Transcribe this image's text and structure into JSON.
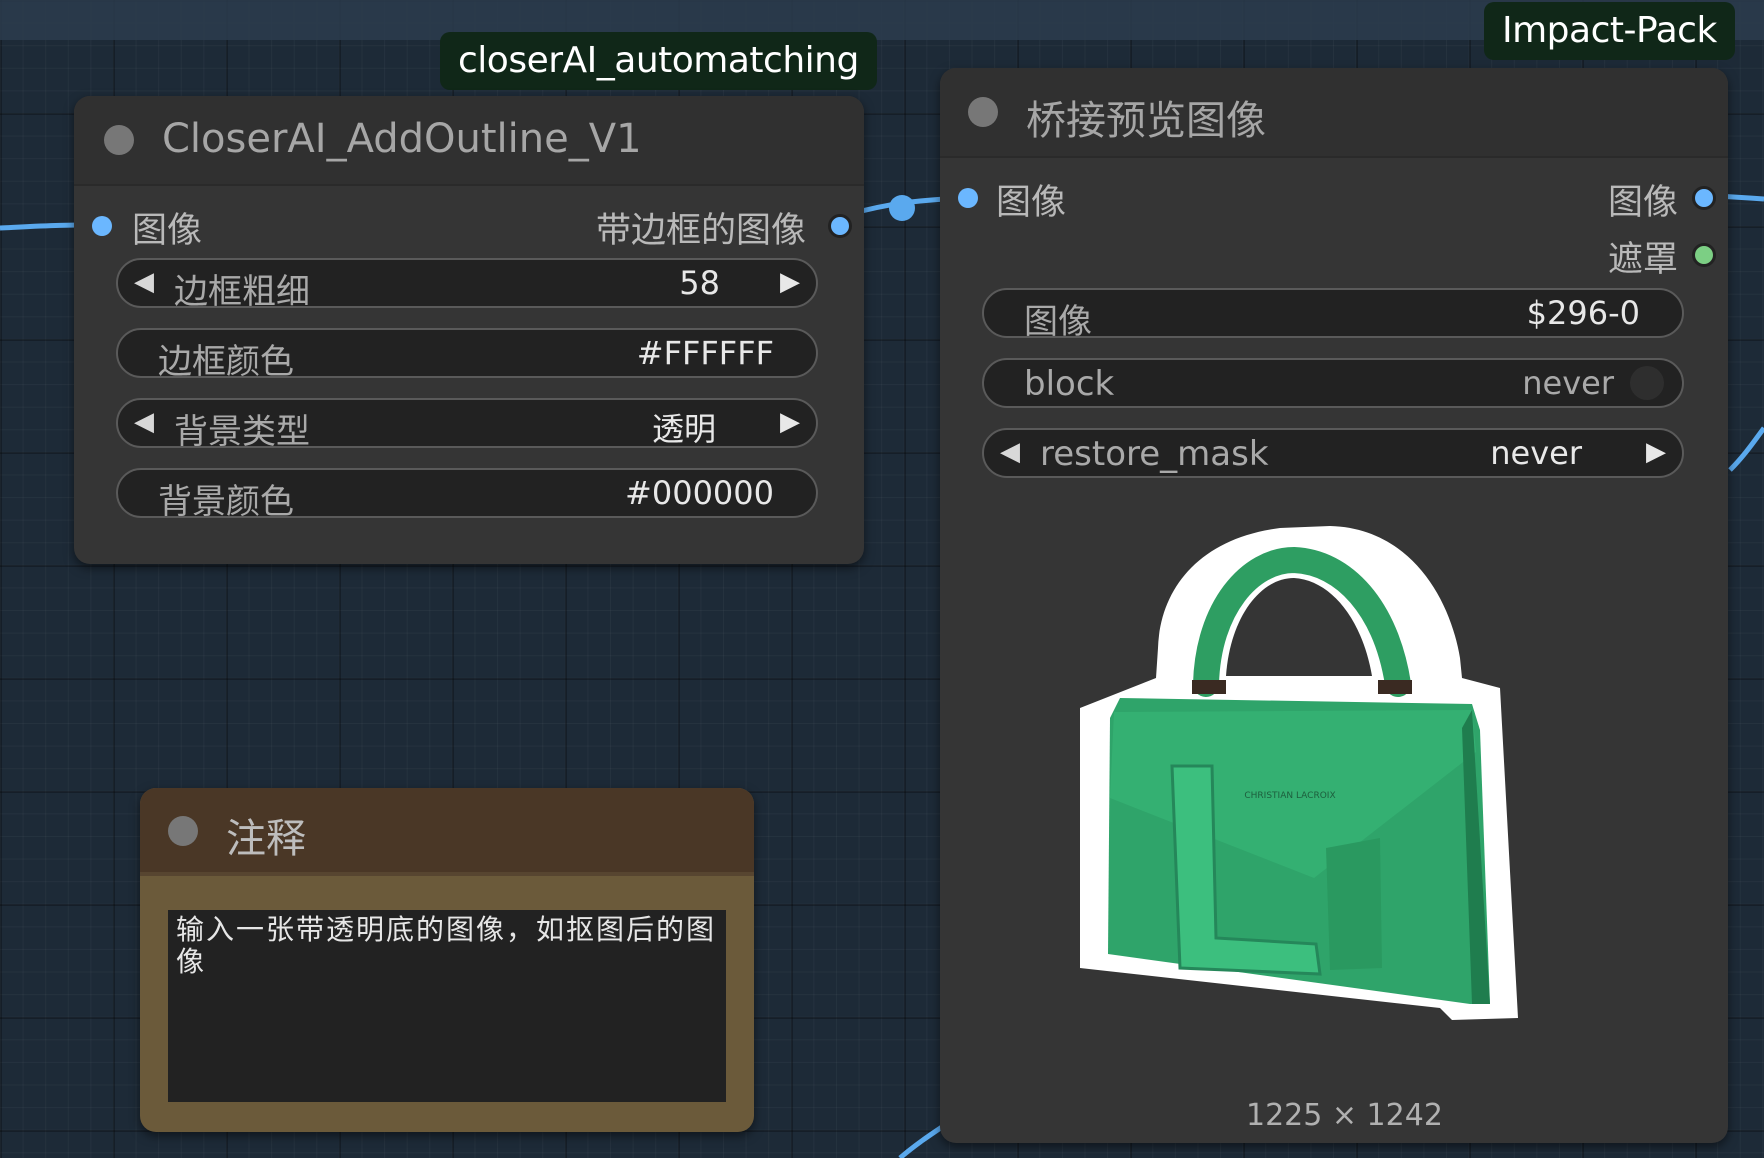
{
  "groups": {
    "closer": "closerAI_automatching",
    "impact": "Impact-Pack"
  },
  "node_outline": {
    "title": "CloserAI_AddOutline_V1",
    "input_label": "图像",
    "output_label": "带边框的图像",
    "widgets": {
      "border_width": {
        "label": "边框粗细",
        "value": "58"
      },
      "border_color": {
        "label": "边框颜色",
        "value": "#FFFFFF"
      },
      "bg_type": {
        "label": "背景类型",
        "value": "透明"
      },
      "bg_color": {
        "label": "背景颜色",
        "value": "#000000"
      }
    }
  },
  "node_preview": {
    "title": "桥接预览图像",
    "input_label": "图像",
    "output_image_label": "图像",
    "output_mask_label": "遮罩",
    "widgets": {
      "image": {
        "label": "图像",
        "value": "$296-0"
      },
      "block": {
        "label": "block",
        "value": "never"
      },
      "restore_mask": {
        "label": "restore_mask",
        "value": "never"
      }
    },
    "image_dims": "1225 × 1242",
    "image_icon": "green-handbag-image"
  },
  "note": {
    "title": "注释",
    "text": "输入一张带透明底的图像，如抠图后的图像"
  },
  "colors": {
    "canvas": "#1d2a37",
    "node_bg": "#353535",
    "slot_image": "#6bb7ff",
    "slot_mask": "#7ccf84",
    "link": "#5aa9ee",
    "group_badge": "#102718",
    "note_body": "#6b5a3a",
    "note_header": "#4a3726"
  }
}
